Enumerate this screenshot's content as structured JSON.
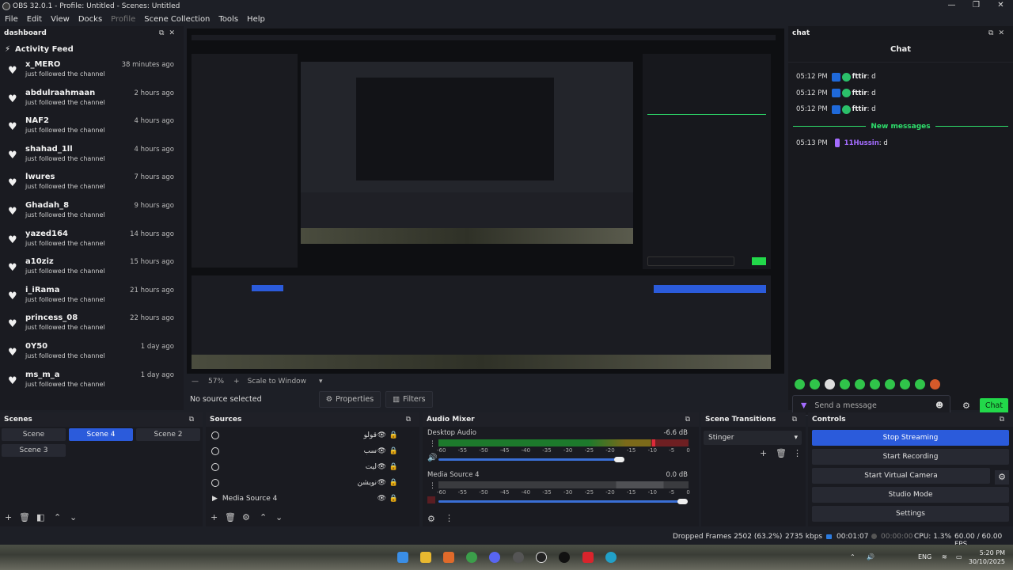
{
  "window": {
    "title": "OBS 32.0.1 - Profile: Untitled - Scenes: Untitled",
    "minimize": "—",
    "maximize": "❐",
    "close": "✕"
  },
  "menu": [
    "File",
    "Edit",
    "View",
    "Docks",
    "Profile",
    "Scene Collection",
    "Tools",
    "Help"
  ],
  "dashboard": {
    "title": "dashboard",
    "feed_title": "Activity Feed",
    "items": [
      {
        "user": "x_MERO",
        "action": "just followed the channel",
        "ago": "38 minutes ago"
      },
      {
        "user": "abdulraahmaan",
        "action": "just followed the channel",
        "ago": "2 hours ago"
      },
      {
        "user": "NAF2",
        "action": "just followed the channel",
        "ago": "4 hours ago"
      },
      {
        "user": "shahad_1ll",
        "action": "just followed the channel",
        "ago": "4 hours ago"
      },
      {
        "user": "lwures",
        "action": "just followed the channel",
        "ago": "7 hours ago"
      },
      {
        "user": "Ghadah_8",
        "action": "just followed the channel",
        "ago": "9 hours ago"
      },
      {
        "user": "yazed164",
        "action": "just followed the channel",
        "ago": "14 hours ago"
      },
      {
        "user": "a10ziz",
        "action": "just followed the channel",
        "ago": "15 hours ago"
      },
      {
        "user": "i_iRama",
        "action": "just followed the channel",
        "ago": "21 hours ago"
      },
      {
        "user": "princess_08",
        "action": "just followed the channel",
        "ago": "22 hours ago"
      },
      {
        "user": "0Y50",
        "action": "just followed the channel",
        "ago": "1 day ago"
      },
      {
        "user": "ms_m_a",
        "action": "just followed the channel",
        "ago": "1 day ago"
      }
    ]
  },
  "preview": {
    "zoom": "57%",
    "scale_mode": "Scale to Window",
    "no_source": "No source selected",
    "properties": "Properties",
    "filters": "Filters"
  },
  "chat": {
    "dock_title": "chat",
    "header": "Chat",
    "messages": [
      {
        "time": "05:12 PM",
        "user": "fttir",
        "text": ": d"
      },
      {
        "time": "05:12 PM",
        "user": "fttir",
        "text": ": d"
      },
      {
        "time": "05:12 PM",
        "user": "fttir",
        "text": ": d"
      }
    ],
    "new_messages": "New messages",
    "after": [
      {
        "time": "05:13 PM",
        "user": "11Hussin",
        "text": ": d"
      }
    ],
    "input_placeholder": "Send a message",
    "send_label": "Chat"
  },
  "scenes": {
    "title": "Scenes",
    "items": [
      "Scene",
      "Scene 4",
      "Scene 2",
      "Scene 3"
    ],
    "active": "Scene 4"
  },
  "sources": {
    "title": "Sources",
    "items": [
      "قولو",
      "سب",
      "ليت",
      "نويشن",
      "Media Source 4"
    ]
  },
  "audio": {
    "title": "Audio Mixer",
    "channels": [
      {
        "name": "Desktop Audio",
        "db": "-6.6 dB",
        "level": 0.78
      },
      {
        "name": "Media Source 4",
        "db": "0.0 dB",
        "level": 0.0
      }
    ],
    "ticks": [
      "-60",
      "-55",
      "-50",
      "-45",
      "-40",
      "-35",
      "-30",
      "-25",
      "-20",
      "-15",
      "-10",
      "-5",
      "0"
    ]
  },
  "transitions": {
    "title": "Scene Transitions",
    "selected": "Stinger"
  },
  "controls": {
    "title": "Controls",
    "buttons": [
      "Stop Streaming",
      "Start Recording",
      "Start Virtual Camera",
      "Studio Mode",
      "Settings"
    ]
  },
  "status": {
    "dropped": "Dropped Frames 2502 (63.2%)",
    "kbps": "2735 kbps",
    "live_time": "00:01:07",
    "rec_time": "00:00:00",
    "cpu": "CPU: 1.3%",
    "fps": "60.00 / 60.00 FPS"
  },
  "taskbar": {
    "lang": "ENG",
    "time": "5:20 PM",
    "date": "30/10/2025"
  },
  "colors": {
    "accent": "#2b5bdb",
    "chat_green": "#22d84a",
    "new_msg": "#2ee06c",
    "purple_user": "#a46cff"
  }
}
